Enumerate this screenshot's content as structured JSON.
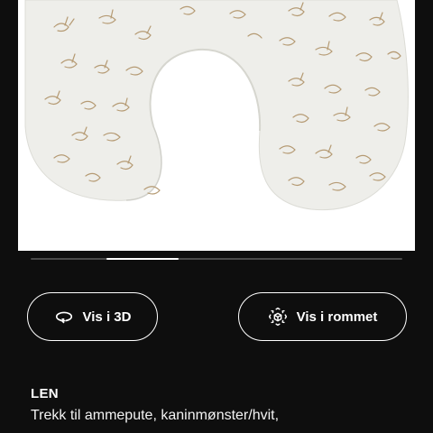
{
  "product_image": {
    "subject": "nursing pillow with rabbit pattern",
    "background_color": "#ffffff",
    "pillow_color": "#eeeeea",
    "pattern_color": "#b59a73"
  },
  "carousel": {
    "active_fraction": 0.19
  },
  "actions": {
    "view_3d_label": "Vis i 3D",
    "view_3d_icon": "rotate-360-icon",
    "view_in_room_label": "Vis i rommet",
    "view_in_room_icon": "ar-cube-icon"
  },
  "product": {
    "name": "LEN",
    "description": "Trekk til ammepute, kaninmønster/hvit,"
  },
  "colors": {
    "page_background": "#0e0e0e",
    "text": "#ffffff",
    "track": "#4a4a4a"
  }
}
